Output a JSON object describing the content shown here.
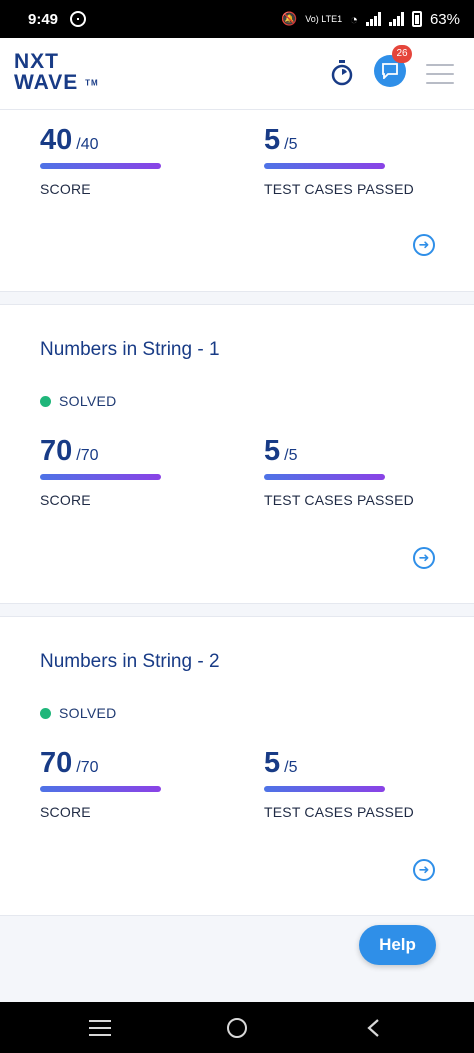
{
  "status_bar": {
    "time": "9:49",
    "network": "Vo) LTE1",
    "battery": "63%"
  },
  "header": {
    "logo_top": "NXT",
    "logo_bottom": "WAVE",
    "logo_tm": "TM",
    "chat_badge_count": "26"
  },
  "cards": [
    {
      "score": "40",
      "score_total": "/40",
      "score_label": "SCORE",
      "tests": "5",
      "tests_total": "/5",
      "tests_label": "TEST CASES PASSED"
    },
    {
      "title": "Numbers in String - 1",
      "status": "SOLVED",
      "score": "70",
      "score_total": "/70",
      "score_label": "SCORE",
      "tests": "5",
      "tests_total": "/5",
      "tests_label": "TEST CASES PASSED"
    },
    {
      "title": "Numbers in String - 2",
      "status": "SOLVED",
      "score": "70",
      "score_total": "/70",
      "score_label": "SCORE",
      "tests": "5",
      "tests_total": "/5",
      "tests_label": "TEST CASES PASSED"
    }
  ],
  "help": {
    "label": "Help"
  },
  "colors": {
    "brand": "#183b86",
    "accent": "#2f8fe8",
    "solved": "#1fb67a",
    "badge": "#e5453b"
  },
  "icons": {
    "timer": "stopwatch-icon",
    "chat": "chat-bubble-icon",
    "menu": "hamburger-menu-icon",
    "arrow": "arrow-right-circle-icon"
  }
}
